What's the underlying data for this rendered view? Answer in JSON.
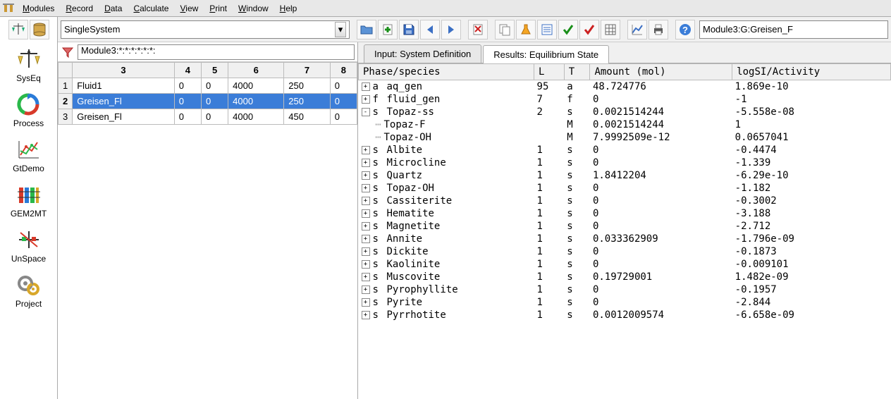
{
  "menu": [
    "Modules",
    "Record",
    "Data",
    "Calculate",
    "View",
    "Print",
    "Window",
    "Help"
  ],
  "rail": [
    {
      "label": "SysEq"
    },
    {
      "label": "Process"
    },
    {
      "label": "GtDemo"
    },
    {
      "label": "GEM2MT"
    },
    {
      "label": "UnSpace"
    },
    {
      "label": "Project"
    }
  ],
  "combo_value": "SingleSystem",
  "module_path": "Module3:G:Greisen_F",
  "filter_text": "Module3:*:*:*:*:*:*:",
  "grid": {
    "headers": [
      "",
      "3",
      "4",
      "5",
      "6",
      "7",
      "8"
    ],
    "rows": [
      {
        "num": "1",
        "cells": [
          "Fluid1",
          "0",
          "0",
          "4000",
          "250",
          "0"
        ],
        "selected": false
      },
      {
        "num": "2",
        "cells": [
          "Greisen_Fl",
          "0",
          "0",
          "4000",
          "250",
          "0"
        ],
        "selected": true
      },
      {
        "num": "3",
        "cells": [
          "Greisen_Fl",
          "0",
          "0",
          "4000",
          "450",
          "0"
        ],
        "selected": false
      }
    ]
  },
  "tabs": [
    {
      "label": "Input: System Definition",
      "active": false
    },
    {
      "label": "Results: Equilibrium State",
      "active": true
    }
  ],
  "results": {
    "headers": [
      "Phase/species",
      "L",
      "T",
      "Amount (mol)",
      "logSI/Activity"
    ],
    "rows": [
      {
        "toggle": "+",
        "indent": 0,
        "code": "a",
        "name": "aq_gen",
        "L": "95",
        "T": "a",
        "amount": "48.724776",
        "logsi": "1.869e-10"
      },
      {
        "toggle": "+",
        "indent": 0,
        "code": "f",
        "name": "fluid_gen",
        "L": "7",
        "T": "f",
        "amount": "0",
        "logsi": "-1"
      },
      {
        "toggle": "-",
        "indent": 0,
        "code": "s",
        "name": "Topaz-ss",
        "L": "2",
        "T": "s",
        "amount": "0.0021514244",
        "logsi": "-5.558e-08"
      },
      {
        "toggle": "",
        "indent": 1,
        "code": "",
        "name": "Topaz-F",
        "L": "",
        "T": "M",
        "amount": "0.0021514244",
        "logsi": "1"
      },
      {
        "toggle": "",
        "indent": 1,
        "code": "",
        "name": "Topaz-OH",
        "L": "",
        "T": "M",
        "amount": "7.9992509e-12",
        "logsi": "0.0657041"
      },
      {
        "toggle": "+",
        "indent": 0,
        "code": "s",
        "name": "Albite",
        "L": "1",
        "T": "s",
        "amount": "0",
        "logsi": "-0.4474"
      },
      {
        "toggle": "+",
        "indent": 0,
        "code": "s",
        "name": "Microcline",
        "L": "1",
        "T": "s",
        "amount": "0",
        "logsi": "-1.339"
      },
      {
        "toggle": "+",
        "indent": 0,
        "code": "s",
        "name": "Quartz",
        "L": "1",
        "T": "s",
        "amount": "1.8412204",
        "logsi": "-6.29e-10"
      },
      {
        "toggle": "+",
        "indent": 0,
        "code": "s",
        "name": "Topaz-OH",
        "L": "1",
        "T": "s",
        "amount": "0",
        "logsi": "-1.182"
      },
      {
        "toggle": "+",
        "indent": 0,
        "code": "s",
        "name": "Cassiterite",
        "L": "1",
        "T": "s",
        "amount": "0",
        "logsi": "-0.3002"
      },
      {
        "toggle": "+",
        "indent": 0,
        "code": "s",
        "name": "Hematite",
        "L": "1",
        "T": "s",
        "amount": "0",
        "logsi": "-3.188"
      },
      {
        "toggle": "+",
        "indent": 0,
        "code": "s",
        "name": "Magnetite",
        "L": "1",
        "T": "s",
        "amount": "0",
        "logsi": "-2.712"
      },
      {
        "toggle": "+",
        "indent": 0,
        "code": "s",
        "name": "Annite",
        "L": "1",
        "T": "s",
        "amount": "0.033362909",
        "logsi": "-1.796e-09"
      },
      {
        "toggle": "+",
        "indent": 0,
        "code": "s",
        "name": "Dickite",
        "L": "1",
        "T": "s",
        "amount": "0",
        "logsi": "-0.1873"
      },
      {
        "toggle": "+",
        "indent": 0,
        "code": "s",
        "name": "Kaolinite",
        "L": "1",
        "T": "s",
        "amount": "0",
        "logsi": "-0.009101"
      },
      {
        "toggle": "+",
        "indent": 0,
        "code": "s",
        "name": "Muscovite",
        "L": "1",
        "T": "s",
        "amount": "0.19729001",
        "logsi": "1.482e-09"
      },
      {
        "toggle": "+",
        "indent": 0,
        "code": "s",
        "name": "Pyrophyllite",
        "L": "1",
        "T": "s",
        "amount": "0",
        "logsi": "-0.1957"
      },
      {
        "toggle": "+",
        "indent": 0,
        "code": "s",
        "name": "Pyrite",
        "L": "1",
        "T": "s",
        "amount": "0",
        "logsi": "-2.844"
      },
      {
        "toggle": "+",
        "indent": 0,
        "code": "s",
        "name": "Pyrrhotite",
        "L": "1",
        "T": "s",
        "amount": "0.0012009574",
        "logsi": "-6.658e-09"
      }
    ]
  }
}
